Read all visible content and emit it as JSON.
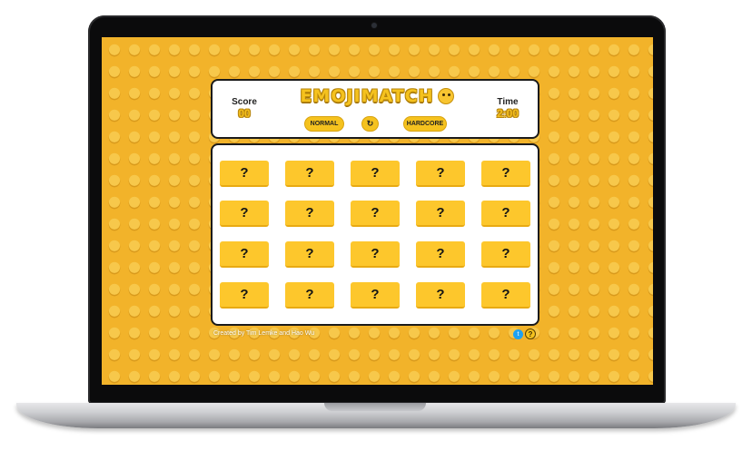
{
  "header": {
    "score_label": "Score",
    "score_value": "00",
    "title": "EMOJIMATCH",
    "time_label": "Time",
    "time_value": "2:00"
  },
  "controls": {
    "normal_label": "NORMAL",
    "restart_icon": "↻",
    "hardcore_label": "HARDCORE"
  },
  "board": {
    "cards": [
      {
        "face": "?"
      },
      {
        "face": "?"
      },
      {
        "face": "?"
      },
      {
        "face": "?"
      },
      {
        "face": "?"
      },
      {
        "face": "?"
      },
      {
        "face": "?"
      },
      {
        "face": "?"
      },
      {
        "face": "?"
      },
      {
        "face": "?"
      },
      {
        "face": "?"
      },
      {
        "face": "?"
      },
      {
        "face": "?"
      },
      {
        "face": "?"
      },
      {
        "face": "?"
      },
      {
        "face": "?"
      },
      {
        "face": "?"
      },
      {
        "face": "?"
      },
      {
        "face": "?"
      },
      {
        "face": "?"
      }
    ]
  },
  "footer": {
    "credit": "Created by Tim Lemke and Hao Wu",
    "twitter_icon": "twitter-icon",
    "help_icon": "?"
  },
  "colors": {
    "accent": "#f5c21e",
    "card": "#fdc72c",
    "background": "#f2b32a"
  }
}
